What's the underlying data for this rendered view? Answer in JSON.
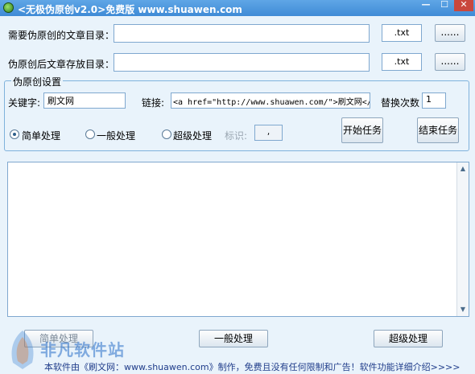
{
  "window": {
    "title": "<无极伪原创v2.0>免费版 www.shuawen.com",
    "min_glyph": "—",
    "max_glyph": "☐",
    "close_glyph": "✕"
  },
  "source_dir": {
    "label": "需要伪原创的文章目录：",
    "value": "",
    "ext": ".txt",
    "browse_label": "......"
  },
  "target_dir": {
    "label": "伪原创后文章存放目录：",
    "value": "",
    "ext": ".txt",
    "browse_label": "......"
  },
  "settings": {
    "group_title": "伪原创设置",
    "keyword_label": "关键字:",
    "keyword_value": "刷文网",
    "link_label": "链接:",
    "link_value": "<a href=\"http://www.shuawen.com/\">刷文网</a>",
    "replace_count_label": "替换次数",
    "replace_count_value": "1",
    "radios": [
      {
        "label": "简单处理",
        "checked": true
      },
      {
        "label": "一般处理",
        "checked": false
      },
      {
        "label": "超级处理",
        "checked": false
      }
    ],
    "marker_label": "标识:",
    "marker_value": ",",
    "start_button": "开始任务",
    "stop_button": "结束任务"
  },
  "output": {
    "text": "",
    "scroll_up": "▲",
    "scroll_down": "▼"
  },
  "mode_buttons": {
    "simple": "简单处理",
    "normal": "一般处理",
    "super": "超级处理"
  },
  "footer": {
    "text": "本软件由《刷文网：www.shuawen.com》制作，免费且没有任何限制和广告！软件功能详细介绍>>>>"
  },
  "watermark": {
    "text": "非凡软件站"
  },
  "colors": {
    "titlebar": "#3f8bd6",
    "window_bg": "#e9f3fb",
    "border": "#7fa8cf",
    "close_button": "#c9473d"
  }
}
